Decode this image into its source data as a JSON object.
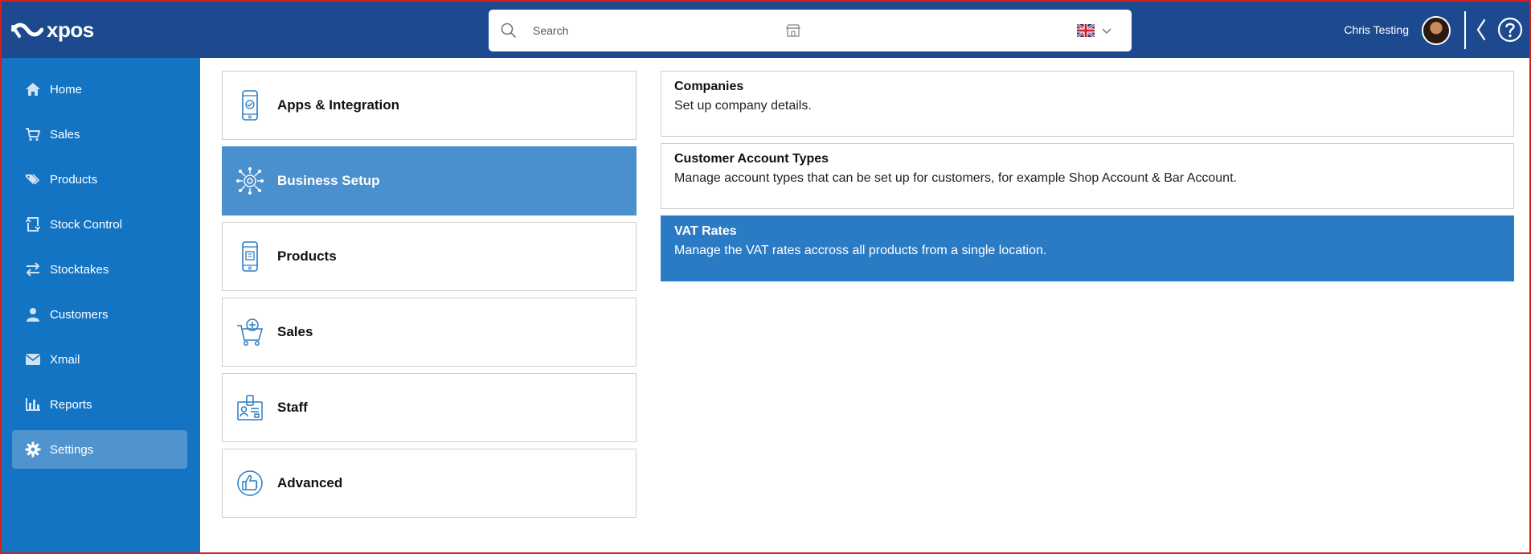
{
  "app": {
    "logo_text": "xpos"
  },
  "search": {
    "placeholder": "Search"
  },
  "user": {
    "name": "Chris Testing"
  },
  "sidebar": {
    "items": [
      {
        "label": "Home",
        "icon": "home-icon",
        "active": false
      },
      {
        "label": "Sales",
        "icon": "cart-icon",
        "active": false
      },
      {
        "label": "Products",
        "icon": "tags-icon",
        "active": false
      },
      {
        "label": "Stock Control",
        "icon": "stock-icon",
        "active": false
      },
      {
        "label": "Stocktakes",
        "icon": "exchange-icon",
        "active": false
      },
      {
        "label": "Customers",
        "icon": "user-icon",
        "active": false
      },
      {
        "label": "Xmail",
        "icon": "mail-icon",
        "active": false
      },
      {
        "label": "Reports",
        "icon": "bar-chart-icon",
        "active": false
      },
      {
        "label": "Settings",
        "icon": "gear-icon",
        "active": true
      }
    ]
  },
  "categories": [
    {
      "label": "Apps & Integration",
      "icon": "phone-app-icon",
      "active": false
    },
    {
      "label": "Business Setup",
      "icon": "network-gear-icon",
      "active": true
    },
    {
      "label": "Products",
      "icon": "phone-product-icon",
      "active": false
    },
    {
      "label": "Sales",
      "icon": "cart-plus-icon",
      "active": false
    },
    {
      "label": "Staff",
      "icon": "id-badge-icon",
      "active": false
    },
    {
      "label": "Advanced",
      "icon": "thumbs-up-icon",
      "active": false
    }
  ],
  "settings_items": [
    {
      "title": "Companies",
      "description": "Set up company details.",
      "active": false
    },
    {
      "title": "Customer Account Types",
      "description": "Manage account types that can be set up for customers, for example Shop Account & Bar Account.",
      "active": false
    },
    {
      "title": "VAT Rates",
      "description": "Manage the VAT rates accross all products from a single location.",
      "active": true
    }
  ],
  "colors": {
    "topbar": "#1d4a8f",
    "sidebar": "#1474c4",
    "sidebar_active": "#4f94cf",
    "category_active": "#4a90ce",
    "item_active": "#2a7bc4"
  }
}
